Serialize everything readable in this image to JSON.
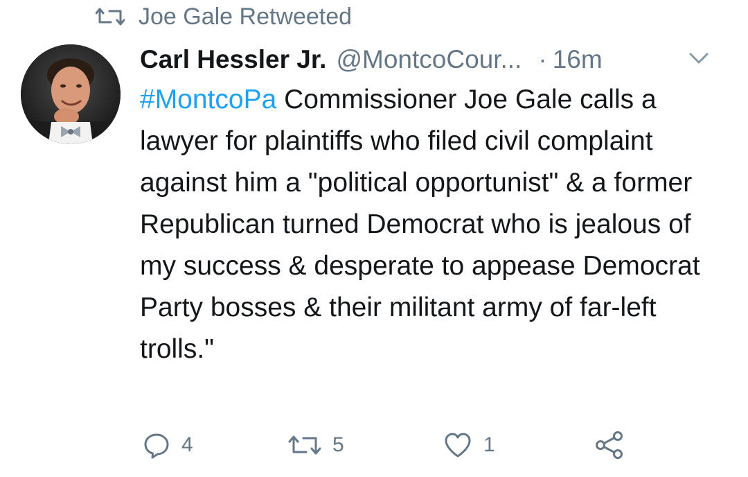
{
  "retweet_context": {
    "text": "Joe Gale Retweeted",
    "icon": "retweet-icon"
  },
  "tweet": {
    "author": {
      "display_name": "Carl Hessler Jr.",
      "handle": "@MontcoCour...",
      "avatar": "author-avatar"
    },
    "separator": "·",
    "timestamp": "16m",
    "hashtag": "#MontcoPa",
    "body": " Commissioner Joe Gale calls a lawyer for plaintiffs who filed civil complaint against him a \"political opportunist\" & a former Republican turned Democrat who is jealous of my success & desperate to appease Democrat Party bosses & their militant army of far-left trolls.\""
  },
  "actions": {
    "reply": {
      "icon": "reply-icon",
      "count": "4"
    },
    "retweet": {
      "icon": "retweet-icon",
      "count": "5"
    },
    "like": {
      "icon": "heart-icon",
      "count": "1"
    },
    "share": {
      "icon": "share-icon"
    }
  },
  "colors": {
    "text": "#14171a",
    "secondary": "#657786",
    "link": "#1da1f2",
    "background": "#ffffff"
  }
}
